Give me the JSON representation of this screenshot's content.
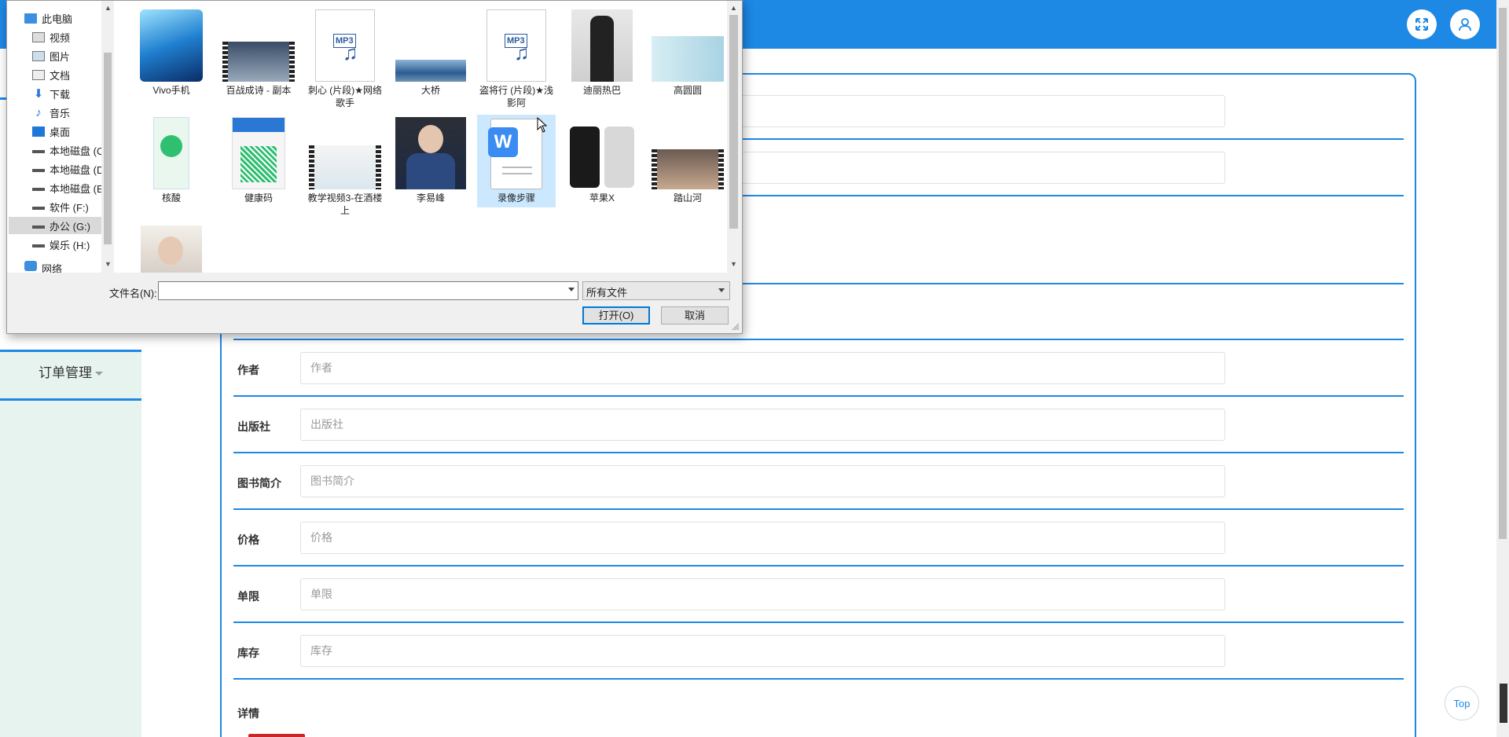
{
  "header": {
    "fullscreen_icon": "expand-icon",
    "user_icon": "user-icon"
  },
  "sidebar": {
    "menu_label": "订单管理"
  },
  "form": {
    "fields": [
      {
        "label": "作者",
        "placeholder": "作者"
      },
      {
        "label": "出版社",
        "placeholder": "出版社"
      },
      {
        "label": "图书简介",
        "placeholder": "图书简介"
      },
      {
        "label": "价格",
        "placeholder": "价格"
      },
      {
        "label": "单限",
        "placeholder": "单限"
      },
      {
        "label": "库存",
        "placeholder": "库存"
      }
    ],
    "detail_label": "详情"
  },
  "top_button": "Top",
  "dialog": {
    "nav": [
      {
        "label": "此电脑",
        "icon": "computer-icon"
      },
      {
        "label": "视频",
        "icon": "video-folder-icon"
      },
      {
        "label": "图片",
        "icon": "pictures-folder-icon"
      },
      {
        "label": "文档",
        "icon": "documents-folder-icon"
      },
      {
        "label": "下载",
        "icon": "download-icon"
      },
      {
        "label": "音乐",
        "icon": "music-icon"
      },
      {
        "label": "桌面",
        "icon": "desktop-icon"
      },
      {
        "label": "本地磁盘 (C:",
        "icon": "drive-icon"
      },
      {
        "label": "本地磁盘 (D:",
        "icon": "drive-icon"
      },
      {
        "label": "本地磁盘 (E:",
        "icon": "drive-icon"
      },
      {
        "label": "软件 (F:)",
        "icon": "drive-icon"
      },
      {
        "label": "办公 (G:)",
        "icon": "drive-icon"
      },
      {
        "label": "娱乐 (H:)",
        "icon": "drive-icon"
      },
      {
        "label": "网络",
        "icon": "network-icon"
      }
    ],
    "files": [
      {
        "name": "Vivo手机"
      },
      {
        "name": "百战成诗 - 副本"
      },
      {
        "name": "刺心 (片段)★网络歌手"
      },
      {
        "name": "大桥"
      },
      {
        "name": "盗将行 (片段)★浅影阿"
      },
      {
        "name": "迪丽热巴"
      },
      {
        "name": "高圆圆"
      },
      {
        "name": "核酸"
      },
      {
        "name": "健康码"
      },
      {
        "name": "教学视频3-在酒楼上"
      },
      {
        "name": "李易峰"
      },
      {
        "name": "录像步骤"
      },
      {
        "name": "苹果X"
      },
      {
        "name": "踏山河"
      },
      {
        "name": ""
      }
    ],
    "filename_label": "文件名(N):",
    "filename_value": "",
    "filetype": "所有文件",
    "open_label": "打开(O)",
    "cancel_label": "取消"
  }
}
